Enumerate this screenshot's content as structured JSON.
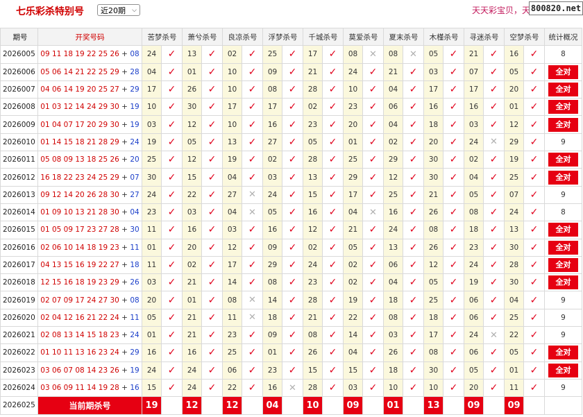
{
  "header": {
    "title": "七乐彩杀特别号",
    "select_value": "近20期",
    "marquee": "天天彩宝贝，天",
    "brand": "800820.net"
  },
  "table": {
    "headers": [
      "期号",
      "开奖号码",
      "苦梦杀号",
      "萧兮杀号",
      "良凉杀号",
      "浮梦杀号",
      "千城杀号",
      "莫爱杀号",
      "夏末杀号",
      "木槿杀号",
      "寻迷杀号",
      "空梦杀号",
      "统计概况"
    ],
    "rows": [
      {
        "issue": "2026005",
        "main": "09 11 18 19 22 25 26",
        "special": "08",
        "kills": [
          [
            "24",
            1
          ],
          [
            "13",
            1
          ],
          [
            "02",
            1
          ],
          [
            "25",
            1
          ],
          [
            "17",
            1
          ],
          [
            "08",
            0
          ],
          [
            "08",
            0
          ],
          [
            "05",
            1
          ],
          [
            "21",
            1
          ],
          [
            "16",
            1
          ]
        ],
        "stat": "8",
        "all": false
      },
      {
        "issue": "2026006",
        "main": "05 06 14 21 22 25 29",
        "special": "28",
        "kills": [
          [
            "04",
            1
          ],
          [
            "01",
            1
          ],
          [
            "10",
            1
          ],
          [
            "09",
            1
          ],
          [
            "21",
            1
          ],
          [
            "24",
            1
          ],
          [
            "21",
            1
          ],
          [
            "03",
            1
          ],
          [
            "07",
            1
          ],
          [
            "05",
            1
          ]
        ],
        "stat": "全对",
        "all": true
      },
      {
        "issue": "2026007",
        "main": "04 06 14 19 20 25 27",
        "special": "29",
        "kills": [
          [
            "17",
            1
          ],
          [
            "26",
            1
          ],
          [
            "10",
            1
          ],
          [
            "08",
            1
          ],
          [
            "28",
            1
          ],
          [
            "10",
            1
          ],
          [
            "04",
            1
          ],
          [
            "17",
            1
          ],
          [
            "17",
            1
          ],
          [
            "20",
            1
          ]
        ],
        "stat": "全对",
        "all": true
      },
      {
        "issue": "2026008",
        "main": "01 03 12 14 24 29 30",
        "special": "19",
        "kills": [
          [
            "10",
            1
          ],
          [
            "30",
            1
          ],
          [
            "17",
            1
          ],
          [
            "17",
            1
          ],
          [
            "02",
            1
          ],
          [
            "23",
            1
          ],
          [
            "06",
            1
          ],
          [
            "16",
            1
          ],
          [
            "16",
            1
          ],
          [
            "01",
            1
          ]
        ],
        "stat": "全对",
        "all": true
      },
      {
        "issue": "2026009",
        "main": "01 04 07 17 20 29 30",
        "special": "19",
        "kills": [
          [
            "03",
            1
          ],
          [
            "12",
            1
          ],
          [
            "10",
            1
          ],
          [
            "16",
            1
          ],
          [
            "23",
            1
          ],
          [
            "20",
            1
          ],
          [
            "04",
            1
          ],
          [
            "18",
            1
          ],
          [
            "03",
            1
          ],
          [
            "12",
            1
          ]
        ],
        "stat": "全对",
        "all": true
      },
      {
        "issue": "2026010",
        "main": "01 14 15 18 21 28 29",
        "special": "24",
        "kills": [
          [
            "19",
            1
          ],
          [
            "05",
            1
          ],
          [
            "13",
            1
          ],
          [
            "27",
            1
          ],
          [
            "05",
            1
          ],
          [
            "01",
            1
          ],
          [
            "02",
            1
          ],
          [
            "20",
            1
          ],
          [
            "24",
            0
          ],
          [
            "29",
            1
          ]
        ],
        "stat": "9",
        "all": false
      },
      {
        "issue": "2026011",
        "main": "05 08 09 13 18 25 26",
        "special": "20",
        "kills": [
          [
            "25",
            1
          ],
          [
            "12",
            1
          ],
          [
            "19",
            1
          ],
          [
            "02",
            1
          ],
          [
            "28",
            1
          ],
          [
            "25",
            1
          ],
          [
            "29",
            1
          ],
          [
            "30",
            1
          ],
          [
            "02",
            1
          ],
          [
            "19",
            1
          ]
        ],
        "stat": "全对",
        "all": true
      },
      {
        "issue": "2026012",
        "main": "16 18 22 23 24 25 29",
        "special": "07",
        "kills": [
          [
            "30",
            1
          ],
          [
            "15",
            1
          ],
          [
            "04",
            1
          ],
          [
            "03",
            1
          ],
          [
            "13",
            1
          ],
          [
            "29",
            1
          ],
          [
            "12",
            1
          ],
          [
            "30",
            1
          ],
          [
            "04",
            1
          ],
          [
            "25",
            1
          ]
        ],
        "stat": "全对",
        "all": true
      },
      {
        "issue": "2026013",
        "main": "09 12 14 20 26 28 30",
        "special": "27",
        "kills": [
          [
            "24",
            1
          ],
          [
            "22",
            1
          ],
          [
            "27",
            0
          ],
          [
            "24",
            1
          ],
          [
            "15",
            1
          ],
          [
            "17",
            1
          ],
          [
            "25",
            1
          ],
          [
            "21",
            1
          ],
          [
            "05",
            1
          ],
          [
            "07",
            1
          ]
        ],
        "stat": "9",
        "all": false
      },
      {
        "issue": "2026014",
        "main": "01 09 10 13 21 28 30",
        "special": "04",
        "kills": [
          [
            "23",
            1
          ],
          [
            "03",
            1
          ],
          [
            "04",
            0
          ],
          [
            "05",
            1
          ],
          [
            "16",
            1
          ],
          [
            "04",
            0
          ],
          [
            "16",
            1
          ],
          [
            "26",
            1
          ],
          [
            "08",
            1
          ],
          [
            "24",
            1
          ]
        ],
        "stat": "8",
        "all": false
      },
      {
        "issue": "2026015",
        "main": "01 05 09 17 23 27 28",
        "special": "30",
        "kills": [
          [
            "11",
            1
          ],
          [
            "16",
            1
          ],
          [
            "03",
            1
          ],
          [
            "16",
            1
          ],
          [
            "12",
            1
          ],
          [
            "21",
            1
          ],
          [
            "24",
            1
          ],
          [
            "08",
            1
          ],
          [
            "18",
            1
          ],
          [
            "13",
            1
          ]
        ],
        "stat": "全对",
        "all": true
      },
      {
        "issue": "2026016",
        "main": "02 06 10 14 18 19 23",
        "special": "11",
        "kills": [
          [
            "01",
            1
          ],
          [
            "20",
            1
          ],
          [
            "12",
            1
          ],
          [
            "09",
            1
          ],
          [
            "02",
            1
          ],
          [
            "05",
            1
          ],
          [
            "13",
            1
          ],
          [
            "26",
            1
          ],
          [
            "23",
            1
          ],
          [
            "30",
            1
          ]
        ],
        "stat": "全对",
        "all": true
      },
      {
        "issue": "2026017",
        "main": "04 13 15 16 19 22 27",
        "special": "18",
        "kills": [
          [
            "11",
            1
          ],
          [
            "02",
            1
          ],
          [
            "17",
            1
          ],
          [
            "29",
            1
          ],
          [
            "24",
            1
          ],
          [
            "02",
            1
          ],
          [
            "06",
            1
          ],
          [
            "12",
            1
          ],
          [
            "24",
            1
          ],
          [
            "28",
            1
          ]
        ],
        "stat": "全对",
        "all": true
      },
      {
        "issue": "2026018",
        "main": "12 15 16 18 19 23 29",
        "special": "26",
        "kills": [
          [
            "03",
            1
          ],
          [
            "21",
            1
          ],
          [
            "14",
            1
          ],
          [
            "08",
            1
          ],
          [
            "23",
            1
          ],
          [
            "02",
            1
          ],
          [
            "04",
            1
          ],
          [
            "05",
            1
          ],
          [
            "19",
            1
          ],
          [
            "30",
            1
          ]
        ],
        "stat": "全对",
        "all": true
      },
      {
        "issue": "2026019",
        "main": "02 07 09 17 24 27 30",
        "special": "08",
        "kills": [
          [
            "20",
            1
          ],
          [
            "01",
            1
          ],
          [
            "08",
            0
          ],
          [
            "14",
            1
          ],
          [
            "28",
            1
          ],
          [
            "19",
            1
          ],
          [
            "18",
            1
          ],
          [
            "25",
            1
          ],
          [
            "06",
            1
          ],
          [
            "04",
            1
          ]
        ],
        "stat": "9",
        "all": false
      },
      {
        "issue": "2026020",
        "main": "02 04 12 16 21 22 24",
        "special": "11",
        "kills": [
          [
            "05",
            1
          ],
          [
            "21",
            1
          ],
          [
            "11",
            0
          ],
          [
            "18",
            1
          ],
          [
            "21",
            1
          ],
          [
            "22",
            1
          ],
          [
            "08",
            1
          ],
          [
            "18",
            1
          ],
          [
            "06",
            1
          ],
          [
            "25",
            1
          ]
        ],
        "stat": "9",
        "all": false
      },
      {
        "issue": "2026021",
        "main": "02 08 13 14 15 18 23",
        "special": "24",
        "kills": [
          [
            "01",
            1
          ],
          [
            "21",
            1
          ],
          [
            "23",
            1
          ],
          [
            "09",
            1
          ],
          [
            "08",
            1
          ],
          [
            "14",
            1
          ],
          [
            "03",
            1
          ],
          [
            "17",
            1
          ],
          [
            "24",
            0
          ],
          [
            "22",
            1
          ]
        ],
        "stat": "9",
        "all": false
      },
      {
        "issue": "2026022",
        "main": "01 10 11 13 16 23 24",
        "special": "29",
        "kills": [
          [
            "16",
            1
          ],
          [
            "16",
            1
          ],
          [
            "25",
            1
          ],
          [
            "01",
            1
          ],
          [
            "26",
            1
          ],
          [
            "04",
            1
          ],
          [
            "26",
            1
          ],
          [
            "08",
            1
          ],
          [
            "06",
            1
          ],
          [
            "05",
            1
          ]
        ],
        "stat": "全对",
        "all": true
      },
      {
        "issue": "2026023",
        "main": "03 06 07 08 14 23 26",
        "special": "19",
        "kills": [
          [
            "24",
            1
          ],
          [
            "24",
            1
          ],
          [
            "06",
            1
          ],
          [
            "23",
            1
          ],
          [
            "15",
            1
          ],
          [
            "15",
            1
          ],
          [
            "18",
            1
          ],
          [
            "30",
            1
          ],
          [
            "05",
            1
          ],
          [
            "01",
            1
          ]
        ],
        "stat": "全对",
        "all": true
      },
      {
        "issue": "2026024",
        "main": "03 06 09 11 14 19 28",
        "special": "16",
        "kills": [
          [
            "15",
            1
          ],
          [
            "24",
            1
          ],
          [
            "22",
            1
          ],
          [
            "16",
            0
          ],
          [
            "28",
            1
          ],
          [
            "03",
            1
          ],
          [
            "10",
            1
          ],
          [
            "10",
            1
          ],
          [
            "20",
            1
          ],
          [
            "11",
            1
          ]
        ],
        "stat": "9",
        "all": false
      }
    ],
    "current": {
      "issue": "2026025",
      "label": "当前期杀号",
      "values": [
        "19",
        "12",
        "12",
        "04",
        "10",
        "09",
        "01",
        "13",
        "09",
        "09"
      ]
    }
  },
  "colors": {
    "accent_red": "#e60012",
    "special_blue": "#1a3ec9",
    "kill_bg": "#fbf8dd"
  },
  "icons": {
    "ok": "check-mark",
    "no": "cross-mark"
  }
}
